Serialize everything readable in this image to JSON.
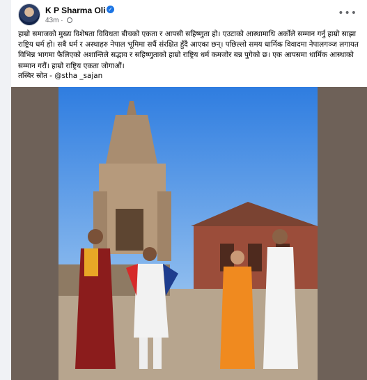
{
  "post": {
    "author": "K P Sharma Oli",
    "time": "43m",
    "visibility_icon": "globe-icon",
    "more_icon": "more-options-icon",
    "text": "हाम्रो समाजको मुख्य विशेषता विविधता बीचको एकता र आपसी सहिष्णुता हो। एउटाको आस्थामाथि अर्कोले सम्मान गर्नु हाम्रो साझा राष्ट्रिय धर्म हो। सबै धर्म र अस्थाहरु नेपाल भूमिमा सधैं संरक्षित हुँदै आएका छन्। पछिल्लो समय धार्मिक विवादमा नेपालगञ्ज लगायत विभिन्न भागमा फैलिएको अशान्तिले सद्भाव र सहिष्णुताको हाम्रो राष्ट्रिय धर्म कमजोर बन्न पुगेको छ। एक आपसमा धार्मिक आस्थाको सम्मान गरौं। हाम्रो राष्ट्रिय एकता जोगाऔं।",
    "credit": "तस्बिर स्रोत - @stha _sajan"
  },
  "colors": {
    "link": "#1b74e4",
    "secondary_text": "#65676b",
    "photo_border": "#6e6158"
  }
}
